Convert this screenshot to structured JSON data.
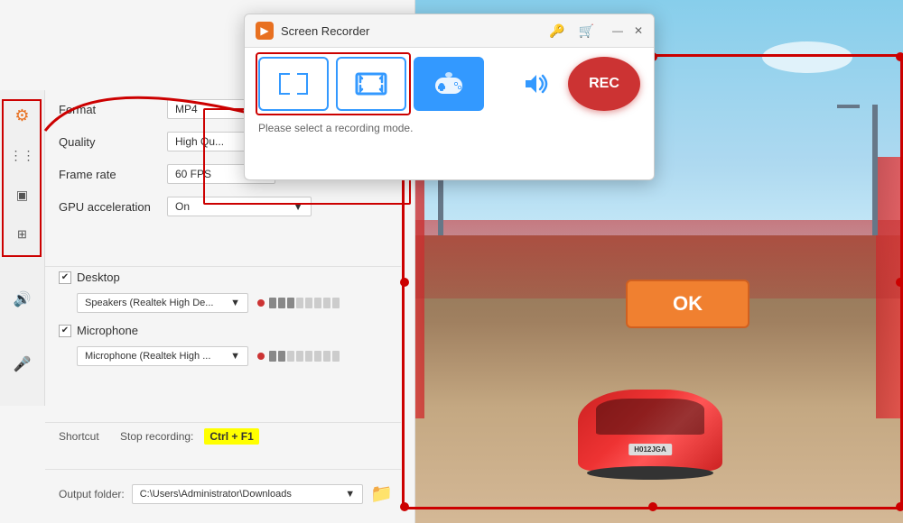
{
  "app": {
    "title": "Screen Recorder",
    "icon": "▶"
  },
  "popup": {
    "title": "Screen Recorder",
    "hint": "Please select a recording mode.",
    "modes": [
      {
        "id": "custom",
        "label": "⤢",
        "active": false
      },
      {
        "id": "fullscreen",
        "label": "⛶",
        "active": false
      },
      {
        "id": "game",
        "label": "🎮",
        "active": true
      }
    ],
    "audio_icon": "🔊",
    "rec_label": "REC",
    "title_icons": [
      "🔑",
      "🛒"
    ],
    "win_controls": [
      "—",
      "✕"
    ]
  },
  "settings": {
    "format": {
      "label": "Format",
      "value": "MP4"
    },
    "quality": {
      "label": "Quality",
      "value": "High Qu..."
    },
    "framerate": {
      "label": "Frame rate",
      "value": "60 FPS"
    },
    "gpu": {
      "label": "GPU acceleration",
      "value": "On"
    }
  },
  "audio": {
    "desktop": {
      "label": "Desktop",
      "checked": true,
      "device": "Speakers (Realtek High De...",
      "dropdown_arrow": "▼"
    },
    "microphone": {
      "label": "Microphone",
      "checked": true,
      "device": "Microphone (Realtek High ...",
      "dropdown_arrow": "▼"
    }
  },
  "shortcut": {
    "label": "Shortcut",
    "stop_label": "Stop recording:",
    "key": "Ctrl + F1"
  },
  "output": {
    "label": "Output folder:",
    "path": "C:\\Users\\Administrator\\Downloads",
    "dropdown_arrow": "▼"
  },
  "game": {
    "ok_label": "OK"
  },
  "icons": {
    "gear": "⚙",
    "layers": "☰",
    "frame": "▣",
    "gpu": "⊞",
    "speaker": "🔊",
    "mic": "🎤",
    "folder": "📁",
    "chevron_down": "▼",
    "checkmark": "✓",
    "check_small": "✔"
  }
}
